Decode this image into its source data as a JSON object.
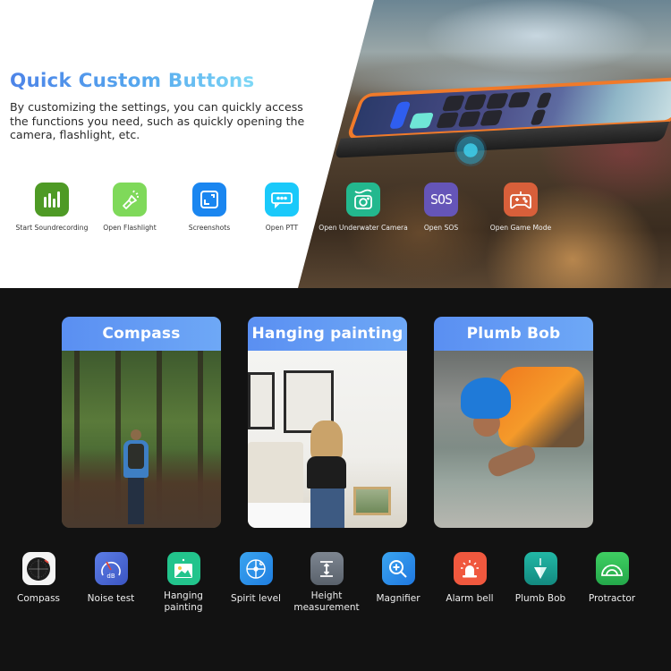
{
  "header": {
    "title": "Quick Custom Buttons",
    "description": "By customizing the settings, you can quickly access the functions you need, such as quickly opening the camera, flashlight, etc."
  },
  "quick_buttons": [
    {
      "label": "Start Soundrecording",
      "icon": "sound-recording-icon",
      "color": "#4e9a25"
    },
    {
      "label": "Open Flashlight",
      "icon": "flashlight-icon",
      "color": "#7fd95a"
    },
    {
      "label": "Screenshots",
      "icon": "screenshot-icon",
      "color": "#1a86f0"
    },
    {
      "label": "Open PTT",
      "icon": "ptt-message-icon",
      "color": "#1ac9fa"
    },
    {
      "label": "Open Underwater Camera",
      "icon": "underwater-camera-icon",
      "color": "#23b88e"
    },
    {
      "label": "Open SOS",
      "icon": "sos-icon",
      "color": "#6555b8",
      "glyph": "SOS"
    },
    {
      "label": "Open Game Mode",
      "icon": "gamepad-icon",
      "color": "#d85f3a"
    }
  ],
  "feature_cards": [
    {
      "title": "Compass",
      "image": "hiker-in-forest-photo"
    },
    {
      "title": "Hanging painting",
      "image": "woman-hanging-frames-photo"
    },
    {
      "title": "Plumb Bob",
      "image": "construction-worker-photo"
    }
  ],
  "tools": [
    {
      "label": "Compass",
      "icon": "compass-icon"
    },
    {
      "label": "Noise test",
      "icon": "decibel-meter-icon",
      "glyph": "dB"
    },
    {
      "label": "Hanging painting",
      "line1": "Hanging",
      "line2": "painting",
      "icon": "picture-icon"
    },
    {
      "label": "Spirit level",
      "icon": "spirit-level-icon"
    },
    {
      "label": "Height measurement",
      "line1": "Height",
      "line2": "measurement",
      "icon": "height-icon"
    },
    {
      "label": "Magnifier",
      "icon": "magnifier-icon"
    },
    {
      "label": "Alarm bell",
      "icon": "alarm-light-icon"
    },
    {
      "label": "Plumb Bob",
      "icon": "plumb-bob-icon"
    },
    {
      "label": "Protractor",
      "icon": "protractor-icon"
    }
  ]
}
